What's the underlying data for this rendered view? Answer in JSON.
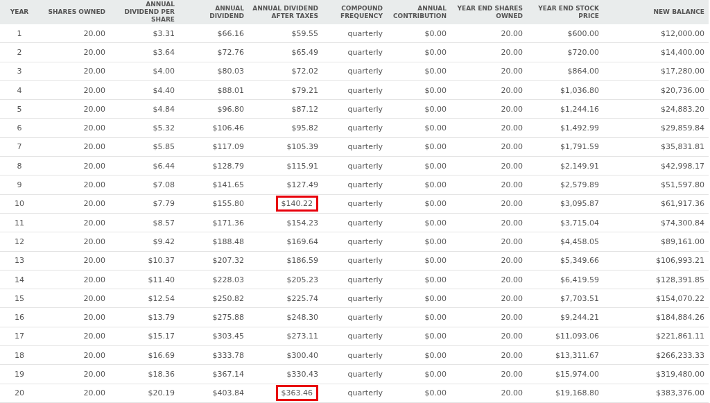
{
  "table": {
    "columns": [
      "YEAR",
      "SHARES OWNED",
      "ANNUAL DIVIDEND PER SHARE",
      "ANNUAL DIVIDEND",
      "ANNUAL DIVIDEND AFTER TAXES",
      "COMPOUND FREQUENCY",
      "ANNUAL CONTRIBUTION",
      "YEAR END SHARES OWNED",
      "YEAR END STOCK PRICE",
      "NEW BALANCE"
    ],
    "rows": [
      {
        "cells": [
          "1",
          "20.00",
          "$3.31",
          "$66.16",
          "$59.55",
          "quarterly",
          "$0.00",
          "20.00",
          "$600.00",
          "$12,000.00"
        ],
        "after_taxes_boxed": false
      },
      {
        "cells": [
          "2",
          "20.00",
          "$3.64",
          "$72.76",
          "$65.49",
          "quarterly",
          "$0.00",
          "20.00",
          "$720.00",
          "$14,400.00"
        ],
        "after_taxes_boxed": false
      },
      {
        "cells": [
          "3",
          "20.00",
          "$4.00",
          "$80.03",
          "$72.02",
          "quarterly",
          "$0.00",
          "20.00",
          "$864.00",
          "$17,280.00"
        ],
        "after_taxes_boxed": false
      },
      {
        "cells": [
          "4",
          "20.00",
          "$4.40",
          "$88.01",
          "$79.21",
          "quarterly",
          "$0.00",
          "20.00",
          "$1,036.80",
          "$20,736.00"
        ],
        "after_taxes_boxed": false
      },
      {
        "cells": [
          "5",
          "20.00",
          "$4.84",
          "$96.80",
          "$87.12",
          "quarterly",
          "$0.00",
          "20.00",
          "$1,244.16",
          "$24,883.20"
        ],
        "after_taxes_boxed": false
      },
      {
        "cells": [
          "6",
          "20.00",
          "$5.32",
          "$106.46",
          "$95.82",
          "quarterly",
          "$0.00",
          "20.00",
          "$1,492.99",
          "$29,859.84"
        ],
        "after_taxes_boxed": false
      },
      {
        "cells": [
          "7",
          "20.00",
          "$5.85",
          "$117.09",
          "$105.39",
          "quarterly",
          "$0.00",
          "20.00",
          "$1,791.59",
          "$35,831.81"
        ],
        "after_taxes_boxed": false
      },
      {
        "cells": [
          "8",
          "20.00",
          "$6.44",
          "$128.79",
          "$115.91",
          "quarterly",
          "$0.00",
          "20.00",
          "$2,149.91",
          "$42,998.17"
        ],
        "after_taxes_boxed": false
      },
      {
        "cells": [
          "9",
          "20.00",
          "$7.08",
          "$141.65",
          "$127.49",
          "quarterly",
          "$0.00",
          "20.00",
          "$2,579.89",
          "$51,597.80"
        ],
        "after_taxes_boxed": false
      },
      {
        "cells": [
          "10",
          "20.00",
          "$7.79",
          "$155.80",
          "$140.22",
          "quarterly",
          "$0.00",
          "20.00",
          "$3,095.87",
          "$61,917.36"
        ],
        "after_taxes_boxed": true
      },
      {
        "cells": [
          "11",
          "20.00",
          "$8.57",
          "$171.36",
          "$154.23",
          "quarterly",
          "$0.00",
          "20.00",
          "$3,715.04",
          "$74,300.84"
        ],
        "after_taxes_boxed": false
      },
      {
        "cells": [
          "12",
          "20.00",
          "$9.42",
          "$188.48",
          "$169.64",
          "quarterly",
          "$0.00",
          "20.00",
          "$4,458.05",
          "$89,161.00"
        ],
        "after_taxes_boxed": false
      },
      {
        "cells": [
          "13",
          "20.00",
          "$10.37",
          "$207.32",
          "$186.59",
          "quarterly",
          "$0.00",
          "20.00",
          "$5,349.66",
          "$106,993.21"
        ],
        "after_taxes_boxed": false
      },
      {
        "cells": [
          "14",
          "20.00",
          "$11.40",
          "$228.03",
          "$205.23",
          "quarterly",
          "$0.00",
          "20.00",
          "$6,419.59",
          "$128,391.85"
        ],
        "after_taxes_boxed": false
      },
      {
        "cells": [
          "15",
          "20.00",
          "$12.54",
          "$250.82",
          "$225.74",
          "quarterly",
          "$0.00",
          "20.00",
          "$7,703.51",
          "$154,070.22"
        ],
        "after_taxes_boxed": false
      },
      {
        "cells": [
          "16",
          "20.00",
          "$13.79",
          "$275.88",
          "$248.30",
          "quarterly",
          "$0.00",
          "20.00",
          "$9,244.21",
          "$184,884.26"
        ],
        "after_taxes_boxed": false
      },
      {
        "cells": [
          "17",
          "20.00",
          "$15.17",
          "$303.45",
          "$273.11",
          "quarterly",
          "$0.00",
          "20.00",
          "$11,093.06",
          "$221,861.11"
        ],
        "after_taxes_boxed": false
      },
      {
        "cells": [
          "18",
          "20.00",
          "$16.69",
          "$333.78",
          "$300.40",
          "quarterly",
          "$0.00",
          "20.00",
          "$13,311.67",
          "$266,233.33"
        ],
        "after_taxes_boxed": false
      },
      {
        "cells": [
          "19",
          "20.00",
          "$18.36",
          "$367.14",
          "$330.43",
          "quarterly",
          "$0.00",
          "20.00",
          "$15,974.00",
          "$319,480.00"
        ],
        "after_taxes_boxed": false
      },
      {
        "cells": [
          "20",
          "20.00",
          "$20.19",
          "$403.84",
          "$363.46",
          "quarterly",
          "$0.00",
          "20.00",
          "$19,168.80",
          "$383,376.00"
        ],
        "after_taxes_boxed": true
      }
    ]
  }
}
